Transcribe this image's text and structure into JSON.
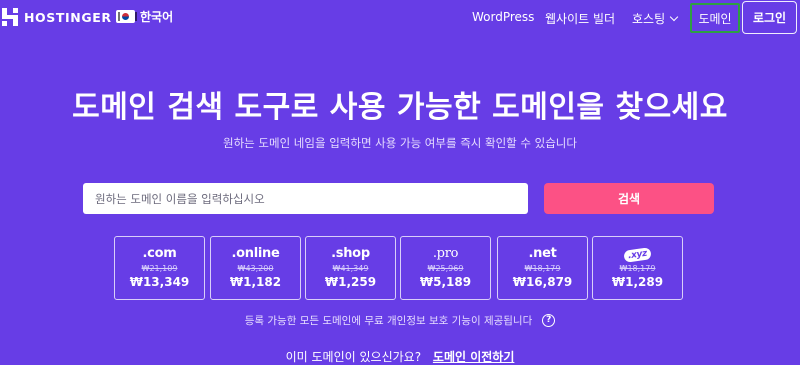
{
  "nav": {
    "logo_text": "HOSTINGER",
    "language": "한국어",
    "links": {
      "wordpress": "WordPress",
      "website_builder": "웹사이트 빌더",
      "hosting": "호스팅",
      "domain": "도메인",
      "login": "로그인"
    }
  },
  "hero": {
    "title": "도메인 검색 도구로 사용 가능한 도메인을 찾으세요",
    "subtitle": "원하는 도메인 네임을 입력하면 사용 가능 여부를 즉시 확인할 수 있습니다",
    "search_placeholder": "원하는 도메인 이름을 입력하십시오",
    "search_button": "검색"
  },
  "tlds": [
    {
      "name": ".com",
      "old_price": "₩21,109",
      "new_price": "₩13,349"
    },
    {
      "name": ".online",
      "old_price": "₩43,200",
      "new_price": "₩1,182"
    },
    {
      "name": ".shop",
      "old_price": "₩41,349",
      "new_price": "₩1,259"
    },
    {
      "name": ".pro",
      "old_price": "₩25,969",
      "new_price": "₩5,189"
    },
    {
      "name": ".net",
      "old_price": "₩18,179",
      "new_price": "₩16,879"
    },
    {
      "name": ".xyz",
      "old_price": "₩18,179",
      "new_price": "₩1,289"
    }
  ],
  "privacy_note": "등록 가능한 모든 도메인에 무료 개인정보 보호 기능이 제공됩니다",
  "help_icon": "?",
  "transfer": {
    "question": "이미 도메인이 있으신가요?",
    "link": "도메인 이전하기"
  },
  "colors": {
    "background": "#673de6",
    "search_button": "#fc5185",
    "domain_highlight": "#2ea043"
  }
}
